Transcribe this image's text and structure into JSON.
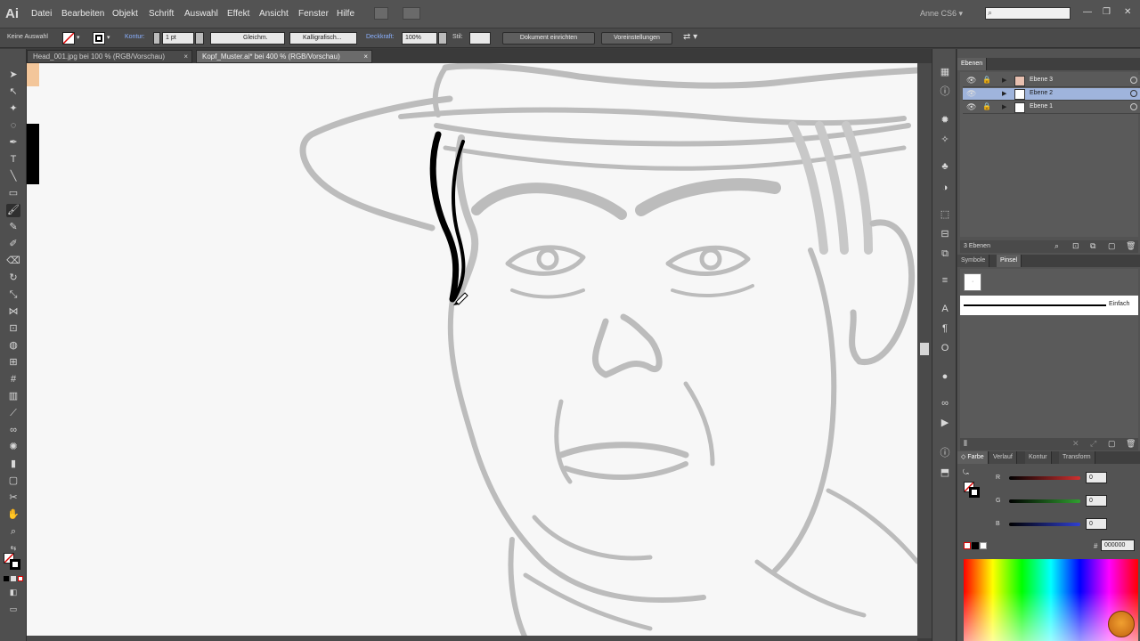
{
  "app": {
    "logo": "Ai",
    "menus": [
      "Datei",
      "Bearbeiten",
      "Objekt",
      "Schrift",
      "Auswahl",
      "Effekt",
      "Ansicht",
      "Fenster",
      "Hilfe"
    ],
    "workspace": "Anne CS6",
    "workspace_arrow": "▾",
    "search_placeholder": "",
    "window_controls": [
      "—",
      "❐",
      "✕"
    ]
  },
  "control_bar": {
    "selection_label": "Keine Auswahl",
    "stroke_label": "Kontur:",
    "stroke_weight": "1 pt",
    "profile": "Gleichm.",
    "brush": "Kalligrafisch...",
    "opacity_label": "Deckkraft:",
    "opacity_value": "100%",
    "style_label": "Stil:",
    "doc_setup_button": "Dokument einrichten",
    "preferences_button": "Voreinstellungen"
  },
  "tabs": [
    {
      "label": "Head_001.jpg bei 100 % (RGB/Vorschau)",
      "close": "×",
      "active": false
    },
    {
      "label": "Kopf_Muster.ai* bei 400 % (RGB/Vorschau)",
      "close": "×",
      "active": true
    }
  ],
  "layers_panel": {
    "tab": "Ebenen",
    "rows": [
      {
        "name": "Ebene 3",
        "selected": false
      },
      {
        "name": "Ebene 2",
        "selected": true
      },
      {
        "name": "Ebene 1",
        "selected": false
      }
    ],
    "count": "3 Ebenen"
  },
  "brushes_panel": {
    "tabs": [
      "Symbole",
      "Pinsel"
    ],
    "active_tab": "Pinsel",
    "brush_name": "Einfach"
  },
  "color_panel": {
    "tabs": [
      "Farbe",
      "Verlauf",
      "Kontur",
      "Transform"
    ],
    "active_tab": "Farbe",
    "channels": [
      {
        "label": "R",
        "value": "0",
        "color": "#d03030"
      },
      {
        "label": "G",
        "value": "0",
        "color": "#30a030"
      },
      {
        "label": "B",
        "value": "0",
        "color": "#3040d0"
      }
    ],
    "hex_label": "#",
    "hex_value": "000000"
  },
  "colors": {
    "chrome": "#535353",
    "canvas": "#f7f7f7",
    "selected_layer": "#9fb4dc",
    "sketch": "#bcbcbc",
    "stroke": "#000000"
  }
}
